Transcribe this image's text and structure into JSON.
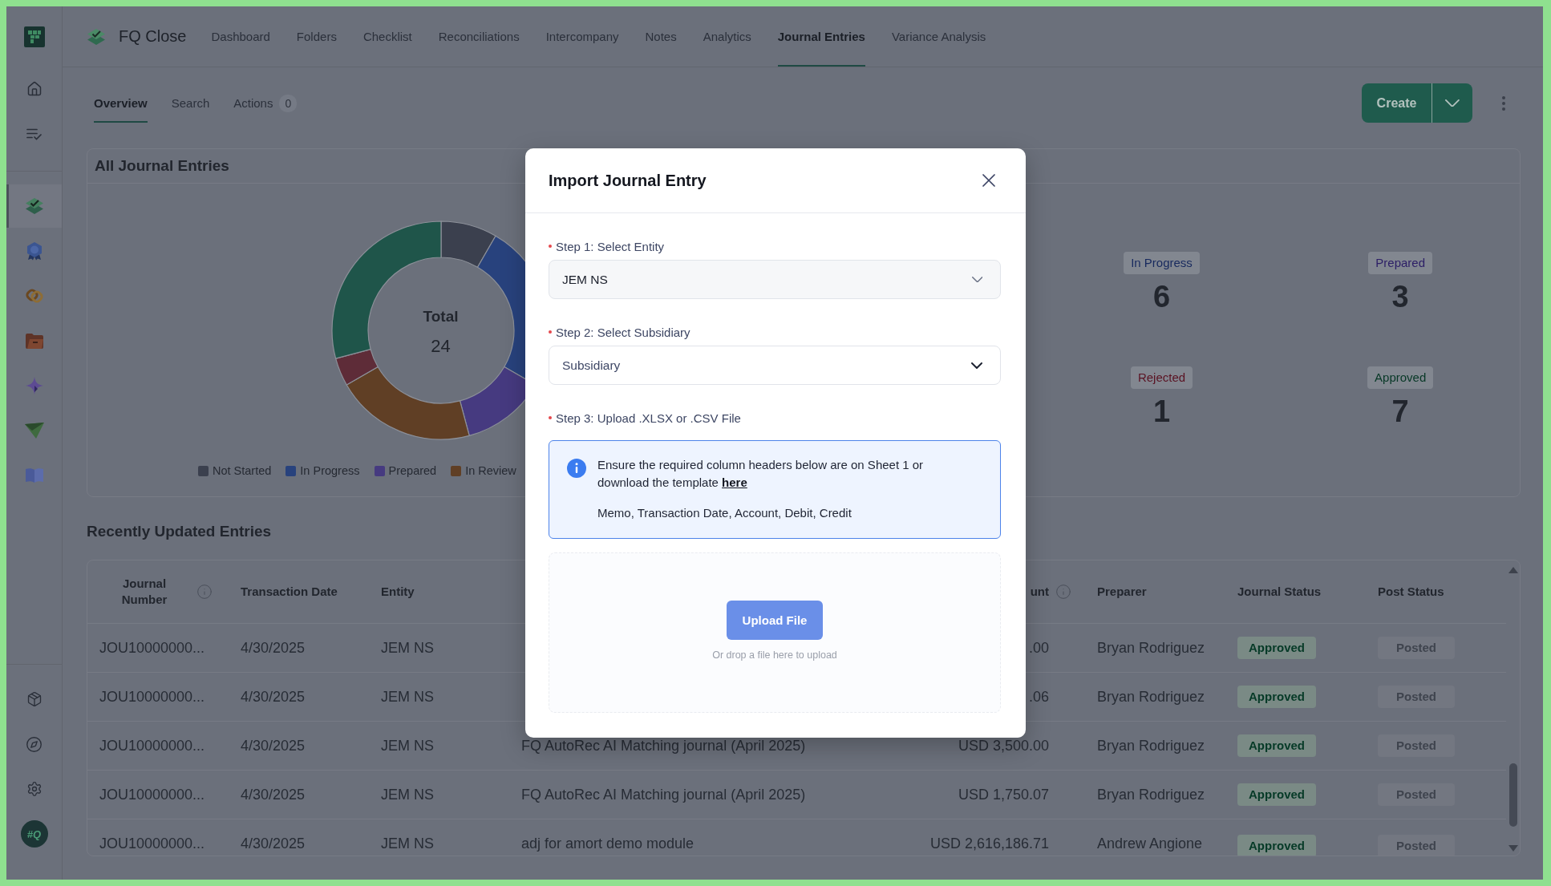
{
  "sidebar": {
    "top_items": [
      {
        "kind": "home",
        "selected": false
      },
      {
        "kind": "tasks",
        "selected": false
      }
    ],
    "apps": [
      {
        "kind": "layers",
        "selected": true
      },
      {
        "kind": "medal",
        "selected": false
      },
      {
        "kind": "rings",
        "selected": false
      },
      {
        "kind": "folder",
        "selected": false
      },
      {
        "kind": "sparkle",
        "selected": false
      },
      {
        "kind": "plane",
        "selected": false
      },
      {
        "kind": "book",
        "selected": false
      }
    ],
    "bottom_items": [
      {
        "kind": "box",
        "selected": false
      },
      {
        "kind": "compass",
        "selected": false
      },
      {
        "kind": "gear",
        "selected": false
      }
    ],
    "avatar": "#Q"
  },
  "app": {
    "name": "FQ Close"
  },
  "nav": [
    {
      "label": "Dashboard",
      "selected": false
    },
    {
      "label": "Folders",
      "selected": false
    },
    {
      "label": "Checklist",
      "selected": false
    },
    {
      "label": "Reconciliations",
      "selected": false
    },
    {
      "label": "Intercompany",
      "selected": false
    },
    {
      "label": "Notes",
      "selected": false
    },
    {
      "label": "Analytics",
      "selected": false
    },
    {
      "label": "Journal Entries",
      "selected": true
    },
    {
      "label": "Variance Analysis",
      "selected": false
    }
  ],
  "subtabs": [
    {
      "label": "Overview",
      "selected": true
    },
    {
      "label": "Search",
      "selected": false
    },
    {
      "label": "Actions",
      "selected": false,
      "count": "0"
    }
  ],
  "create_button": {
    "label": "Create"
  },
  "summary_card": {
    "title": "All Journal Entries",
    "center_label": "Total",
    "center_value": "24",
    "legend": [
      {
        "label": "Not Started",
        "color": "#3b404e"
      },
      {
        "label": "In Progress",
        "color": "#28427d"
      },
      {
        "label": "Prepared",
        "color": "#463a80"
      },
      {
        "label": "In Review",
        "color": "#603f25"
      }
    ],
    "stats": [
      {
        "label": "In Progress",
        "value": "6",
        "color": "#17295e"
      },
      {
        "label": "Prepared",
        "value": "3",
        "color": "#2c1e66"
      },
      {
        "label": "Rejected",
        "value": "1",
        "color": "#5a1222"
      },
      {
        "label": "Approved",
        "value": "7",
        "color": "#073826"
      }
    ]
  },
  "entries": {
    "title": "Recently Updated Entries",
    "columns": [
      {
        "label": "Journal Number",
        "kind": "id",
        "info": true
      },
      {
        "label": "Transaction Date",
        "kind": "text",
        "info": false
      },
      {
        "label": "Entity",
        "kind": "text",
        "info": false
      },
      {
        "kind": "text"
      },
      {
        "label": "unt",
        "kind": "number",
        "info": true
      },
      {
        "label": "Preparer",
        "kind": "text",
        "info": false
      },
      {
        "label": "Journal Status",
        "kind": "status",
        "info": false
      },
      {
        "label": "Post Status",
        "kind": "post",
        "info": false
      }
    ],
    "rows": [
      {
        "journal_number": "JOU10000000...",
        "transaction_date": "4/30/2025",
        "entity": "JEM NS",
        "column_5": ".00",
        "preparer": "Bryan Rodriguez",
        "journal_status": "Approved",
        "post_status": "Posted"
      },
      {
        "journal_number": "JOU10000000...",
        "transaction_date": "4/30/2025",
        "entity": "JEM NS",
        "column_5": ".06",
        "preparer": "Bryan Rodriguez",
        "journal_status": "Approved",
        "post_status": "Posted"
      },
      {
        "journal_number": "JOU10000000...",
        "transaction_date": "4/30/2025",
        "entity": "JEM NS",
        "column_4": "FQ AutoRec AI Matching journal (April 2025)",
        "column_5": "USD 3,500.00",
        "preparer": "Bryan Rodriguez",
        "journal_status": "Approved",
        "post_status": "Posted"
      },
      {
        "journal_number": "JOU10000000...",
        "transaction_date": "4/30/2025",
        "entity": "JEM NS",
        "column_4": "FQ AutoRec AI Matching journal (April 2025)",
        "column_5": "USD 1,750.07",
        "preparer": "Bryan Rodriguez",
        "journal_status": "Approved",
        "post_status": "Posted"
      },
      {
        "journal_number": "JOU10000000...",
        "transaction_date": "4/30/2025",
        "entity": "JEM NS",
        "column_4": "adj for amort demo module",
        "column_5": "USD 2,616,186.71",
        "preparer": "Andrew Angione",
        "journal_status": "Approved",
        "post_status": "Posted"
      }
    ]
  },
  "import_dialog": {
    "title": "Import Journal Entry",
    "steps": [
      {
        "kind": "select",
        "label": "Step 1: Select Entity",
        "required": true,
        "value": "JEM NS",
        "disabled": true
      },
      {
        "kind": "select",
        "label": "Step 2: Select Subsidiary",
        "required": true,
        "placeholder": "Subsidiary",
        "disabled": false
      },
      {
        "kind": "upload",
        "label": "Step 3: Upload .XLSX or .CSV File",
        "required": true,
        "notice": {
          "text": "Ensure the required column headers below are on Sheet 1 or download the template",
          "link": "here",
          "columns": "Memo, Transaction Date, Account, Debit, Credit"
        },
        "button": {
          "label": "Upload File",
          "disabled": true
        },
        "hint": "Or drop a file here to upload"
      }
    ]
  }
}
